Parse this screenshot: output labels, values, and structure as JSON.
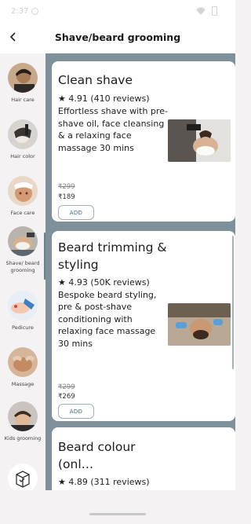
{
  "status": {
    "time": "2:37"
  },
  "header": {
    "title": "Shave/beard grooming"
  },
  "sidebar": {
    "items": [
      {
        "label": "Hair care",
        "icon": "hair-care-photo-icon"
      },
      {
        "label": "Hair color",
        "icon": "hair-color-photo-icon"
      },
      {
        "label": "Face care",
        "icon": "face-care-photo-icon"
      },
      {
        "label": "Shave/ beard grooming",
        "icon": "shave-photo-icon",
        "active": true
      },
      {
        "label": "Pedicure",
        "icon": "pedicure-photo-icon"
      },
      {
        "label": "Massage",
        "icon": "massage-photo-icon"
      },
      {
        "label": "Kids grooming",
        "icon": "kids-grooming-photo-icon"
      },
      {
        "label": "",
        "icon": "package-box-icon"
      }
    ]
  },
  "services": [
    {
      "title": "Clean shave",
      "rating_line": "★ 4.91 (410 reviews)",
      "desc": "Effortless shave with pre-shave oil, face cleansing & a relaxing face massage 30  mins",
      "old_price": "₹299",
      "price": "₹189",
      "add_label": "ADD"
    },
    {
      "title": "Beard trimming & styling",
      "rating_line": "★ 4.93 (50K reviews)  Bespoke beard styling, pre & post-shave conditioning with relaxing face massage 30 mins",
      "old_price": "₹299",
      "price": "₹269",
      "add_label": "ADD"
    },
    {
      "title": "Beard colour (onl…",
      "rating_line": "★ 4.89 (311 reviews)"
    }
  ],
  "colors": {
    "accent": "#3b6a86",
    "panel": "#7e919b"
  }
}
